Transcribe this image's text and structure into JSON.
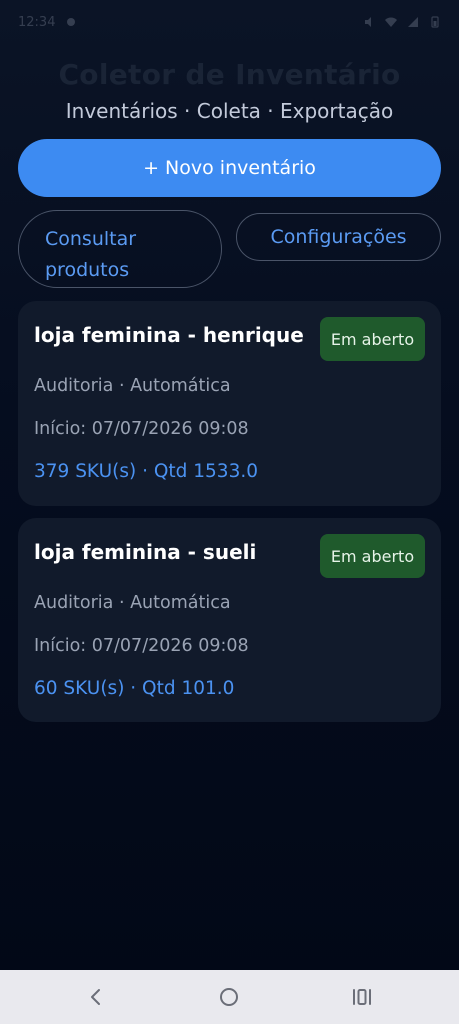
{
  "status_bar": {
    "time": "12:34",
    "icons": [
      "notification-icon",
      "silent-icon",
      "wifi-icon",
      "signal-icon",
      "battery-icon"
    ]
  },
  "header": {
    "title": "Coletor de Inventário",
    "subtitle": "Inventários · Coleta · Exportação"
  },
  "actions": {
    "new_inventory": "+ Novo inventário",
    "consult_products": "Consultar produtos",
    "settings": "Configurações"
  },
  "inventories": [
    {
      "title": "loja feminina - henrique",
      "status": "Em aberto",
      "meta": "Auditoria · Automática",
      "start": "Início: 07/07/2026 09:08",
      "stats": "379 SKU(s) · Qtd 1533.0"
    },
    {
      "title": "loja feminina - sueli",
      "status": "Em aberto",
      "meta": "Auditoria · Automática",
      "start": "Início: 07/07/2026 09:08",
      "stats": "60 SKU(s) · Qtd 101.0"
    }
  ],
  "navigation": {
    "icons": [
      "back-icon",
      "home-icon",
      "recent-apps-icon"
    ]
  },
  "colors": {
    "primary": "#3d8bf2",
    "accent_text": "#4b92f1",
    "status_open": "#1f5a2c",
    "card_background": "#111a2b",
    "background": "#050d1f"
  }
}
